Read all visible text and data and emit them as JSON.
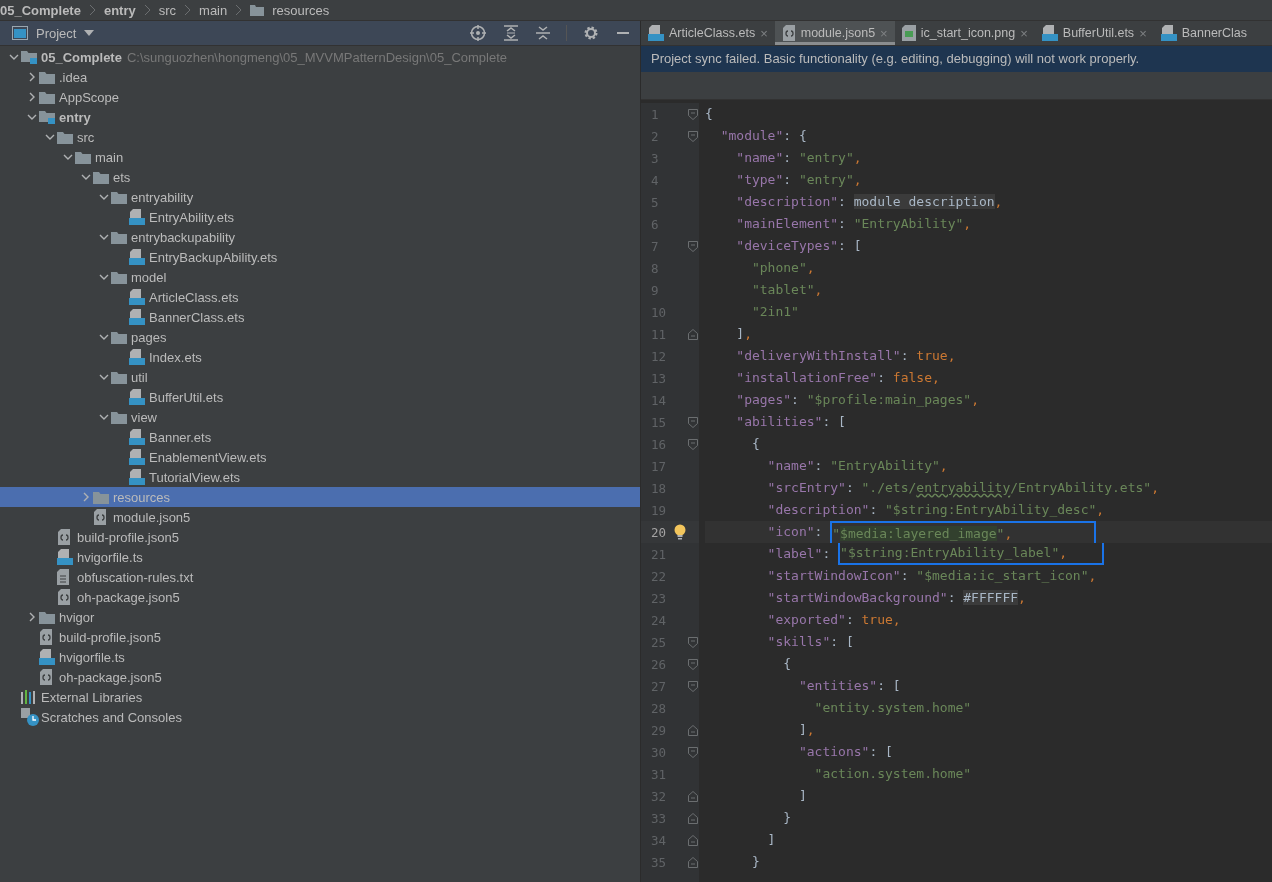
{
  "breadcrumb": [
    {
      "label": "05_Complete",
      "bold": true,
      "kind": "plain"
    },
    {
      "label": "entry",
      "bold": true,
      "kind": "plain"
    },
    {
      "label": "src",
      "bold": false,
      "kind": "plain"
    },
    {
      "label": "main",
      "bold": false,
      "kind": "plain"
    },
    {
      "label": "resources",
      "bold": false,
      "kind": "folder"
    }
  ],
  "project_panel": {
    "title": "Project"
  },
  "project_tree": [
    {
      "label": "05_Complete",
      "kind": "module",
      "path": "C:\\sunguozhen\\hongmeng\\05_MVVMPatternDesign\\05_Complete",
      "expanded": true,
      "selected": false,
      "children": [
        {
          "label": ".idea",
          "kind": "folder",
          "expanded": false,
          "selected": false
        },
        {
          "label": "AppScope",
          "kind": "folder",
          "expanded": false,
          "selected": false
        },
        {
          "label": "entry",
          "kind": "module",
          "expanded": true,
          "selected": false,
          "children": [
            {
              "label": "src",
              "kind": "folder",
              "expanded": true,
              "selected": false,
              "children": [
                {
                  "label": "main",
                  "kind": "folder",
                  "expanded": true,
                  "selected": false,
                  "children": [
                    {
                      "label": "ets",
                      "kind": "folder",
                      "expanded": true,
                      "selected": false,
                      "children": [
                        {
                          "label": "entryability",
                          "kind": "folder",
                          "expanded": true,
                          "selected": false,
                          "children": [
                            {
                              "label": "EntryAbility.ets",
                              "kind": "ets",
                              "selected": false
                            }
                          ]
                        },
                        {
                          "label": "entrybackupability",
                          "kind": "folder",
                          "expanded": true,
                          "selected": false,
                          "children": [
                            {
                              "label": "EntryBackupAbility.ets",
                              "kind": "ets",
                              "selected": false
                            }
                          ]
                        },
                        {
                          "label": "model",
                          "kind": "folder",
                          "expanded": true,
                          "selected": false,
                          "children": [
                            {
                              "label": "ArticleClass.ets",
                              "kind": "ets",
                              "selected": false
                            },
                            {
                              "label": "BannerClass.ets",
                              "kind": "ets",
                              "selected": false
                            }
                          ]
                        },
                        {
                          "label": "pages",
                          "kind": "folder",
                          "expanded": true,
                          "selected": false,
                          "children": [
                            {
                              "label": "Index.ets",
                              "kind": "ets",
                              "selected": false
                            }
                          ]
                        },
                        {
                          "label": "util",
                          "kind": "folder",
                          "expanded": true,
                          "selected": false,
                          "children": [
                            {
                              "label": "BufferUtil.ets",
                              "kind": "ets",
                              "selected": false
                            }
                          ]
                        },
                        {
                          "label": "view",
                          "kind": "folder",
                          "expanded": true,
                          "selected": false,
                          "children": [
                            {
                              "label": "Banner.ets",
                              "kind": "ets",
                              "selected": false
                            },
                            {
                              "label": "EnablementView.ets",
                              "kind": "ets",
                              "selected": false
                            },
                            {
                              "label": "TutorialView.ets",
                              "kind": "ets",
                              "selected": false
                            }
                          ]
                        }
                      ]
                    },
                    {
                      "label": "resources",
                      "kind": "folder",
                      "expanded": false,
                      "selected": true
                    },
                    {
                      "label": "module.json5",
                      "kind": "json",
                      "selected": false
                    }
                  ]
                }
              ]
            },
            {
              "label": "build-profile.json5",
              "kind": "json",
              "selected": false
            },
            {
              "label": "hvigorfile.ts",
              "kind": "ts",
              "selected": false
            },
            {
              "label": "obfuscation-rules.txt",
              "kind": "txt",
              "selected": false
            },
            {
              "label": "oh-package.json5",
              "kind": "json",
              "selected": false
            }
          ]
        },
        {
          "label": "hvigor",
          "kind": "folder",
          "expanded": false,
          "selected": false
        },
        {
          "label": "build-profile.json5",
          "kind": "json",
          "selected": false
        },
        {
          "label": "hvigorfile.ts",
          "kind": "ts",
          "selected": false
        },
        {
          "label": "oh-package.json5",
          "kind": "json",
          "selected": false
        }
      ]
    },
    {
      "label": "External Libraries",
      "kind": "lib",
      "selected": false
    },
    {
      "label": "Scratches and Consoles",
      "kind": "scratch",
      "selected": false
    }
  ],
  "editor_tabs": [
    {
      "label": "ArticleClass.ets",
      "kind": "ets",
      "selected": false,
      "close": "×"
    },
    {
      "label": "module.json5",
      "kind": "json",
      "selected": true,
      "close": "×"
    },
    {
      "label": "ic_start_icon.png",
      "kind": "image",
      "selected": false,
      "close": "×"
    },
    {
      "label": "BufferUtil.ets",
      "kind": "ets",
      "selected": false,
      "close": "×"
    },
    {
      "label": "BannerClas",
      "kind": "ets",
      "selected": false
    }
  ],
  "notification": "Project sync failed. Basic functionality (e.g. editing, debugging) will not work properly.",
  "code_lines": [
    {
      "n": "1",
      "kind": "fold_start",
      "current": false,
      "boxed": false,
      "tokens": [
        {
          "text": "{",
          "kind": "pun"
        }
      ]
    },
    {
      "n": "2",
      "kind": "fold_start",
      "current": false,
      "boxed": false,
      "tokens": [
        {
          "text": "  \"module\"",
          "kind": "key"
        },
        {
          "text": ": {",
          "kind": "pun"
        }
      ]
    },
    {
      "n": "3",
      "kind": "plain",
      "current": false,
      "boxed": false,
      "tokens": [
        {
          "text": "    \"name\"",
          "kind": "key"
        },
        {
          "text": ": ",
          "kind": "pun"
        },
        {
          "text": "\"entry\"",
          "kind": "str"
        },
        {
          "text": ",",
          "kind": "kw"
        }
      ]
    },
    {
      "n": "4",
      "kind": "plain",
      "current": false,
      "boxed": false,
      "tokens": [
        {
          "text": "    \"type\"",
          "kind": "key"
        },
        {
          "text": ": ",
          "kind": "pun"
        },
        {
          "text": "\"entry\"",
          "kind": "str"
        },
        {
          "text": ",",
          "kind": "kw"
        }
      ]
    },
    {
      "n": "5",
      "kind": "plain",
      "current": false,
      "boxed": false,
      "tokens": [
        {
          "text": "    \"description\"",
          "kind": "key"
        },
        {
          "text": ": ",
          "kind": "pun"
        },
        {
          "text": "module description",
          "kind": "dim"
        },
        {
          "text": ",",
          "kind": "kw"
        }
      ]
    },
    {
      "n": "6",
      "kind": "plain",
      "current": false,
      "boxed": false,
      "tokens": [
        {
          "text": "    \"mainElement\"",
          "kind": "key"
        },
        {
          "text": ": ",
          "kind": "pun"
        },
        {
          "text": "\"EntryAbility\"",
          "kind": "str"
        },
        {
          "text": ",",
          "kind": "kw"
        }
      ]
    },
    {
      "n": "7",
      "kind": "fold_start",
      "current": false,
      "boxed": false,
      "tokens": [
        {
          "text": "    \"deviceTypes\"",
          "kind": "key"
        },
        {
          "text": ": [",
          "kind": "pun"
        }
      ]
    },
    {
      "n": "8",
      "kind": "plain",
      "current": false,
      "boxed": false,
      "tokens": [
        {
          "text": "      \"phone\"",
          "kind": "str"
        },
        {
          "text": ",",
          "kind": "kw"
        }
      ]
    },
    {
      "n": "9",
      "kind": "plain",
      "current": false,
      "boxed": false,
      "tokens": [
        {
          "text": "      \"tablet\"",
          "kind": "str"
        },
        {
          "text": ",",
          "kind": "kw"
        }
      ]
    },
    {
      "n": "10",
      "kind": "plain",
      "current": false,
      "boxed": false,
      "tokens": [
        {
          "text": "      \"2in1\"",
          "kind": "str"
        }
      ]
    },
    {
      "n": "11",
      "kind": "fold_end",
      "current": false,
      "boxed": false,
      "tokens": [
        {
          "text": "    ]",
          "kind": "pun"
        },
        {
          "text": ",",
          "kind": "kw"
        }
      ]
    },
    {
      "n": "12",
      "kind": "plain",
      "current": false,
      "boxed": false,
      "tokens": [
        {
          "text": "    \"deliveryWithInstall\"",
          "kind": "key"
        },
        {
          "text": ": ",
          "kind": "pun"
        },
        {
          "text": "true",
          "kind": "kw"
        },
        {
          "text": ",",
          "kind": "kw"
        }
      ]
    },
    {
      "n": "13",
      "kind": "plain",
      "current": false,
      "boxed": false,
      "tokens": [
        {
          "text": "    \"installationFree\"",
          "kind": "key"
        },
        {
          "text": ": ",
          "kind": "pun"
        },
        {
          "text": "false",
          "kind": "kw"
        },
        {
          "text": ",",
          "kind": "kw"
        }
      ]
    },
    {
      "n": "14",
      "kind": "plain",
      "current": false,
      "boxed": false,
      "tokens": [
        {
          "text": "    \"pages\"",
          "kind": "key"
        },
        {
          "text": ": ",
          "kind": "pun"
        },
        {
          "text": "\"$profile:main_pages\"",
          "kind": "str"
        },
        {
          "text": ",",
          "kind": "kw"
        }
      ]
    },
    {
      "n": "15",
      "kind": "fold_start",
      "current": false,
      "boxed": false,
      "tokens": [
        {
          "text": "    \"abilities\"",
          "kind": "key"
        },
        {
          "text": ": [",
          "kind": "pun"
        }
      ]
    },
    {
      "n": "16",
      "kind": "fold_start",
      "current": false,
      "boxed": false,
      "tokens": [
        {
          "text": "      {",
          "kind": "pun"
        }
      ]
    },
    {
      "n": "17",
      "kind": "plain",
      "current": false,
      "boxed": false,
      "tokens": [
        {
          "text": "        \"name\"",
          "kind": "key"
        },
        {
          "text": ": ",
          "kind": "pun"
        },
        {
          "text": "\"EntryAbility\"",
          "kind": "str"
        },
        {
          "text": ",",
          "kind": "kw"
        }
      ]
    },
    {
      "n": "18",
      "kind": "plain",
      "current": false,
      "boxed": false,
      "tokens": [
        {
          "text": "        \"srcEntry\"",
          "kind": "key"
        },
        {
          "text": ": ",
          "kind": "pun"
        },
        {
          "text": "\"./ets/",
          "kind": "str"
        },
        {
          "text": "entryability",
          "kind": "wavy"
        },
        {
          "text": "/EntryAbility.ets\"",
          "kind": "str"
        },
        {
          "text": ",",
          "kind": "kw"
        }
      ]
    },
    {
      "n": "19",
      "kind": "plain",
      "current": false,
      "boxed": false,
      "tokens": [
        {
          "text": "        \"description\"",
          "kind": "key"
        },
        {
          "text": ": ",
          "kind": "pun"
        },
        {
          "text": "\"$string:EntryAbility_desc\"",
          "kind": "str"
        },
        {
          "text": ",",
          "kind": "kw"
        }
      ]
    },
    {
      "n": "20",
      "kind": "plain",
      "current": true,
      "boxed": true,
      "tokens": [
        {
          "text": "        \"icon\"",
          "kind": "key"
        },
        {
          "text": ": ",
          "kind": "pun"
        },
        {
          "text": "\"",
          "kind": "str"
        },
        {
          "text": "$media:layered_image",
          "kind": "match"
        },
        {
          "text": "\"",
          "kind": "str"
        },
        {
          "text": ",",
          "kind": "kw"
        }
      ]
    },
    {
      "n": "21",
      "kind": "plain",
      "current": false,
      "boxed": true,
      "tokens": [
        {
          "text": "        \"label\"",
          "kind": "key"
        },
        {
          "text": ": ",
          "kind": "pun"
        },
        {
          "text": "\"$string:EntryAbility_label\"",
          "kind": "str"
        },
        {
          "text": ",",
          "kind": "kw"
        }
      ]
    },
    {
      "n": "22",
      "kind": "plain",
      "current": false,
      "boxed": false,
      "tokens": [
        {
          "text": "        \"startWindowIcon\"",
          "kind": "key"
        },
        {
          "text": ": ",
          "kind": "pun"
        },
        {
          "text": "\"$media:ic_start_icon\"",
          "kind": "str"
        },
        {
          "text": ",",
          "kind": "kw"
        }
      ]
    },
    {
      "n": "23",
      "kind": "plain",
      "current": false,
      "boxed": false,
      "tokens": [
        {
          "text": "        \"startWindowBackground\"",
          "kind": "key"
        },
        {
          "text": ": ",
          "kind": "pun"
        },
        {
          "text": "#FFFFFF",
          "kind": "dim"
        },
        {
          "text": ",",
          "kind": "kw"
        }
      ]
    },
    {
      "n": "24",
      "kind": "plain",
      "current": false,
      "boxed": false,
      "tokens": [
        {
          "text": "        \"exported\"",
          "kind": "key"
        },
        {
          "text": ": ",
          "kind": "pun"
        },
        {
          "text": "true",
          "kind": "kw"
        },
        {
          "text": ",",
          "kind": "kw"
        }
      ]
    },
    {
      "n": "25",
      "kind": "fold_start",
      "current": false,
      "boxed": false,
      "tokens": [
        {
          "text": "        \"skills\"",
          "kind": "key"
        },
        {
          "text": ": [",
          "kind": "pun"
        }
      ]
    },
    {
      "n": "26",
      "kind": "fold_start",
      "current": false,
      "boxed": false,
      "tokens": [
        {
          "text": "          {",
          "kind": "pun"
        }
      ]
    },
    {
      "n": "27",
      "kind": "fold_start",
      "current": false,
      "boxed": false,
      "tokens": [
        {
          "text": "            \"entities\"",
          "kind": "key"
        },
        {
          "text": ": [",
          "kind": "pun"
        }
      ]
    },
    {
      "n": "28",
      "kind": "plain",
      "current": false,
      "boxed": false,
      "tokens": [
        {
          "text": "              \"entity.system.home\"",
          "kind": "str"
        }
      ]
    },
    {
      "n": "29",
      "kind": "fold_end",
      "current": false,
      "boxed": false,
      "tokens": [
        {
          "text": "            ]",
          "kind": "pun"
        },
        {
          "text": ",",
          "kind": "kw"
        }
      ]
    },
    {
      "n": "30",
      "kind": "fold_start",
      "current": false,
      "boxed": false,
      "tokens": [
        {
          "text": "            \"actions\"",
          "kind": "key"
        },
        {
          "text": ": [",
          "kind": "pun"
        }
      ]
    },
    {
      "n": "31",
      "kind": "plain",
      "current": false,
      "boxed": false,
      "tokens": [
        {
          "text": "              \"action.system.home\"",
          "kind": "str"
        }
      ]
    },
    {
      "n": "32",
      "kind": "fold_end",
      "current": false,
      "boxed": false,
      "tokens": [
        {
          "text": "            ]",
          "kind": "pun"
        }
      ]
    },
    {
      "n": "33",
      "kind": "fold_end",
      "current": false,
      "boxed": false,
      "tokens": [
        {
          "text": "          }",
          "kind": "pun"
        }
      ]
    },
    {
      "n": "34",
      "kind": "fold_end",
      "current": false,
      "boxed": false,
      "tokens": [
        {
          "text": "        ]",
          "kind": "pun"
        }
      ]
    },
    {
      "n": "35",
      "kind": "fold_end",
      "current": false,
      "boxed": false,
      "tokens": [
        {
          "text": "      }",
          "kind": "pun"
        }
      ]
    }
  ]
}
